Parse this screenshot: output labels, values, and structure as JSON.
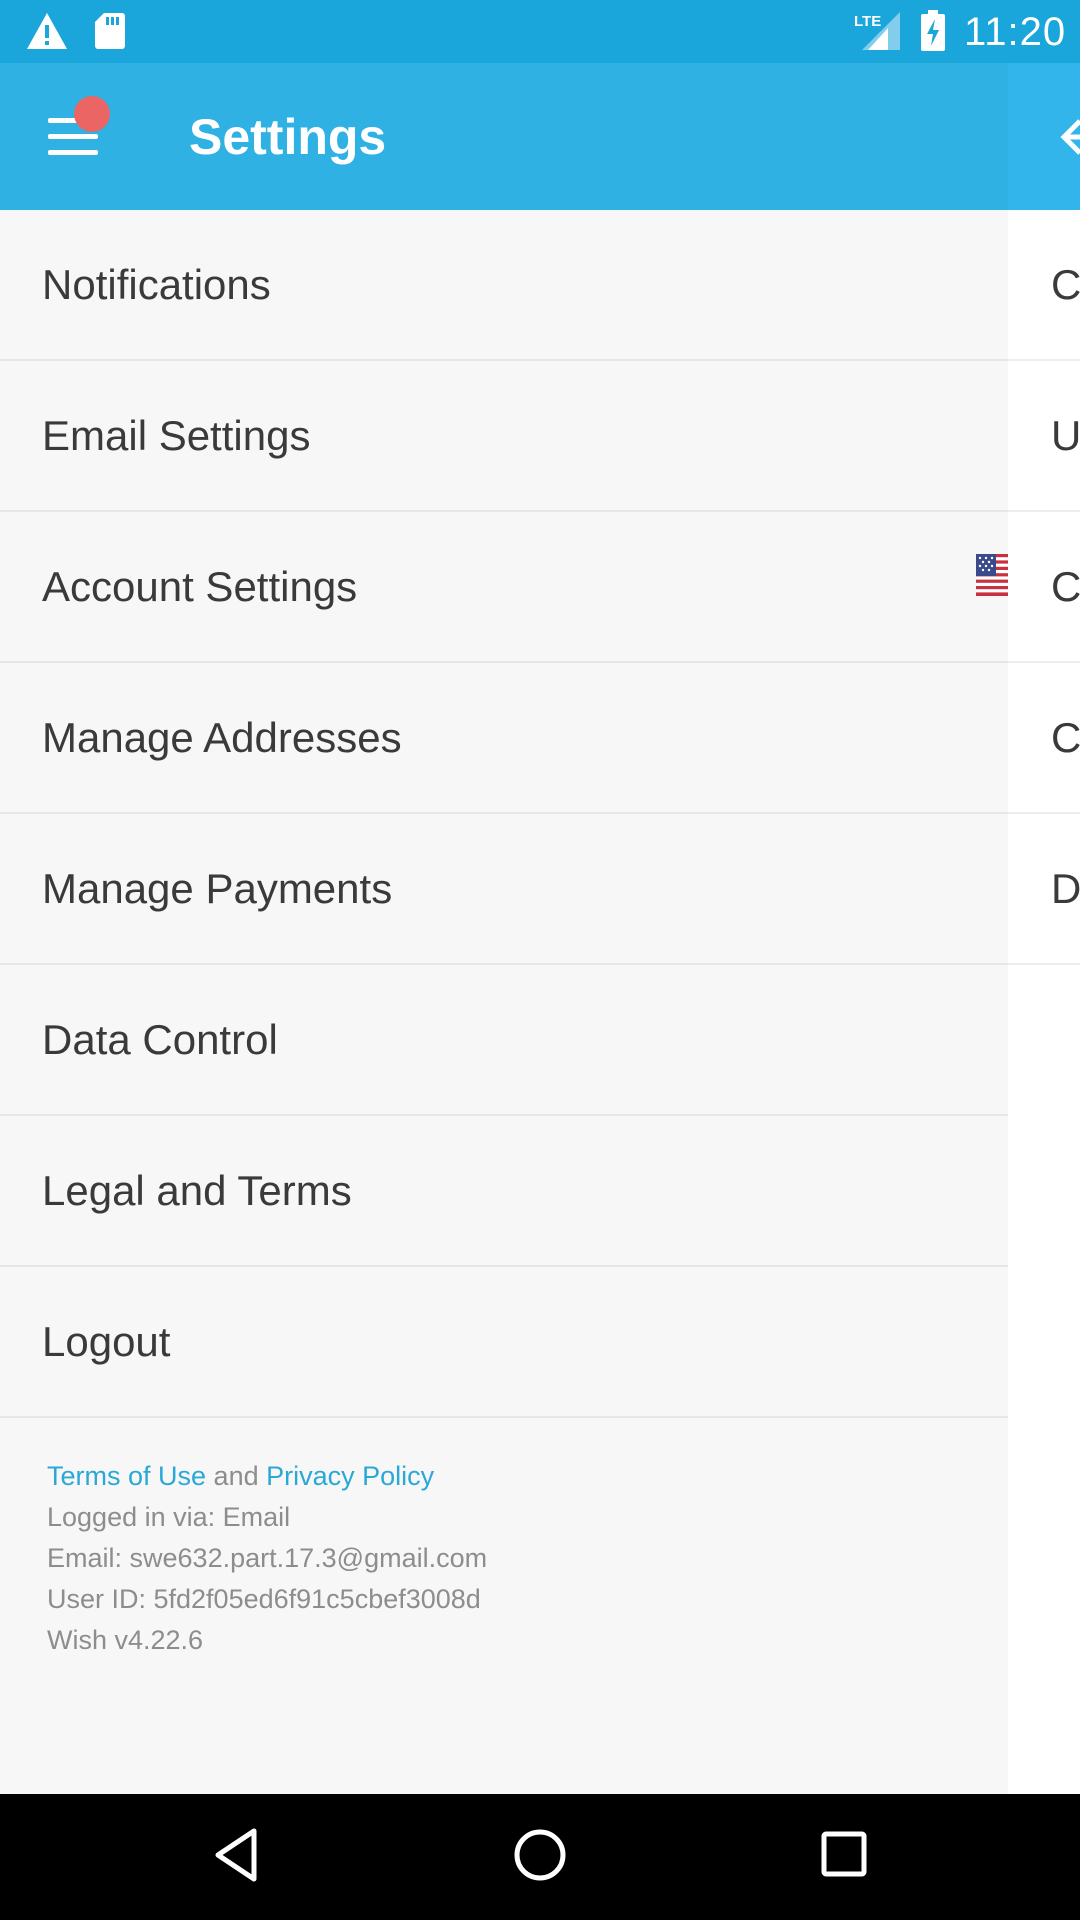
{
  "status_bar": {
    "time": "11:20",
    "network_label": "LTE",
    "icons": [
      "warning-icon",
      "sd-card-icon",
      "lte-signal-icon",
      "battery-charging-icon"
    ]
  },
  "app_bar": {
    "title": "Settings",
    "menu_icon": "hamburger-menu-icon",
    "badge_color": "#ec6565",
    "color": "#2fb1e4"
  },
  "menu": {
    "items": [
      {
        "label": "Notifications"
      },
      {
        "label": "Email Settings"
      },
      {
        "label": "Account Settings"
      },
      {
        "label": "Manage Addresses"
      },
      {
        "label": "Manage Payments"
      },
      {
        "label": "Data Control"
      },
      {
        "label": "Legal and Terms"
      },
      {
        "label": "Logout"
      }
    ]
  },
  "peek": {
    "letters": [
      "C",
      "U",
      "C",
      "C",
      "D"
    ],
    "flag_icon": "us-flag-icon"
  },
  "footer": {
    "terms_link": "Terms of Use",
    "and_text": " and ",
    "privacy_link": "Privacy Policy",
    "login_method": "Logged in via: Email",
    "email": "Email: swe632.part.17.3@gmail.com",
    "user_id": "User ID: 5fd2f05ed6f91c5cbef3008d",
    "version": "Wish v4.22.6",
    "link_color": "#2aa8d8"
  },
  "nav_bar": {
    "buttons": [
      "back-icon",
      "home-icon",
      "recents-icon"
    ]
  }
}
